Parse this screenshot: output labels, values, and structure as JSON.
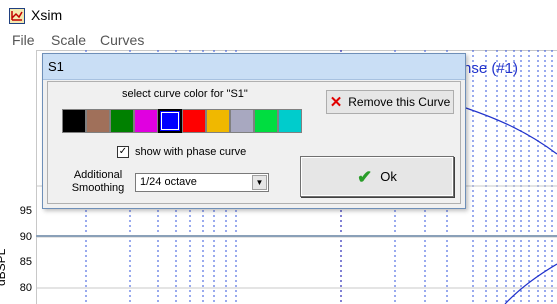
{
  "app": {
    "title": "Xsim",
    "icon": "xsim-app-icon"
  },
  "menu": {
    "items": [
      "File",
      "Scale",
      "Curves"
    ]
  },
  "plot": {
    "title_fragment": "nse (#1)",
    "ylabel": "dBSPL",
    "yticks": [
      "95",
      "90",
      "85",
      "80"
    ],
    "colors": {
      "grid": "#3355dd",
      "curve": "#2233cc",
      "reference": "#8aa0b8"
    }
  },
  "dialog": {
    "title": "S1",
    "color_prompt": "select curve color for \"S1\"",
    "swatches": [
      "#000000",
      "#a0705a",
      "#008000",
      "#e000e0",
      "#0000ff",
      "#ff0000",
      "#f0b800",
      "#a8a8c0",
      "#00dd40",
      "#00cccc"
    ],
    "selected_swatch_index": 4,
    "remove_button": "Remove this Curve",
    "phase_checkbox": {
      "label": "show with phase curve",
      "checked": true
    },
    "smoothing": {
      "label_line1": "Additional",
      "label_line2": "Smoothing",
      "value": "1/24 octave"
    },
    "ok_button": "Ok"
  }
}
